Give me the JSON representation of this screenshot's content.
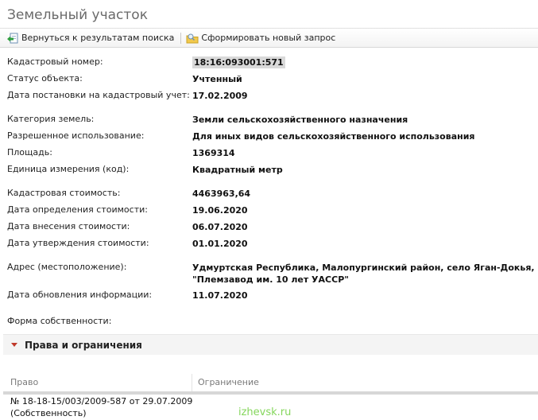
{
  "window": {
    "title": "Земельный участок"
  },
  "toolbar": {
    "back_label": "Вернуться к результатам поиска",
    "new_query_label": "Сформировать новый запрос"
  },
  "fields": [
    {
      "label": "Кадастровый номер:",
      "value": "18:16:093001:571"
    },
    {
      "label": "Статус объекта:",
      "value": "Учтенный"
    },
    {
      "label": "Дата постановки на кадастровый учет:",
      "value": "17.02.2009"
    },
    {
      "label": "Категория земель:",
      "value": "Земли сельскохозяйственного назначения"
    },
    {
      "label": "Разрешенное использование:",
      "value": "Для иных видов сельскохозяйственного использования"
    },
    {
      "label": "Площадь:",
      "value": "1369314"
    },
    {
      "label": "Единица измерения (код):",
      "value": "Квадратный метр"
    },
    {
      "label": "Кадастровая стоимость:",
      "value": "4463963,64"
    },
    {
      "label": "Дата определения стоимости:",
      "value": "19.06.2020"
    },
    {
      "label": "Дата внесения стоимости:",
      "value": "06.07.2020"
    },
    {
      "label": "Дата утверждения стоимости:",
      "value": "01.01.2020"
    },
    {
      "label": "Адрес (местоположение):",
      "value_line1": "Удмуртская Республика, Малопургинский район, село Яган-Докья,",
      "value_line2": "\"Племзавод им. 10 лет УАССР\""
    },
    {
      "label": "Дата обновления информации:",
      "value": "11.07.2020"
    },
    {
      "label": "Форма собственности:",
      "value": ""
    }
  ],
  "rights_section": {
    "title": "Права и ограничения",
    "columns": [
      "Право",
      "Ограничение"
    ],
    "rows": [
      {
        "right_line1": "№ 18-18-15/003/2009-587  от 29.07.2009",
        "right_line2": "(Собственность)"
      }
    ]
  },
  "watermark": "izhevsk.ru",
  "colors": {
    "caret": "#c0392b",
    "watermark": "#66cc33",
    "highlight": "#d9d9d9"
  }
}
